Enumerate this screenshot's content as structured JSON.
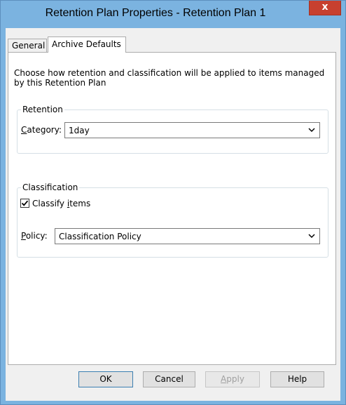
{
  "window": {
    "title": "Retention Plan Properties - Retention Plan 1",
    "close_glyph": "x"
  },
  "tabs": [
    {
      "label": "General",
      "selected": false
    },
    {
      "label": "Archive Defaults",
      "selected": true
    }
  ],
  "panel": {
    "description": "Choose how retention and classification will be applied to items managed by this Retention Plan",
    "retention": {
      "group_label": "Retention",
      "category_label_access": "C",
      "category_label_rest": "ategory:",
      "category_value": "1day"
    },
    "classification": {
      "group_label": "Classification",
      "classify_checked": true,
      "classify_label_pre": "Classify ",
      "classify_label_access": "i",
      "classify_label_post": "tems",
      "policy_label_access": "P",
      "policy_label_rest": "olicy:",
      "policy_value": "Classification Policy"
    }
  },
  "buttons": {
    "ok": "OK",
    "cancel": "Cancel",
    "apply_access": "A",
    "apply_rest": "pply",
    "apply_enabled": false,
    "help": "Help"
  },
  "colors": {
    "frame": "#7bb3e0",
    "close_button": "#c7402f",
    "client_bg": "#f0f0f0"
  }
}
